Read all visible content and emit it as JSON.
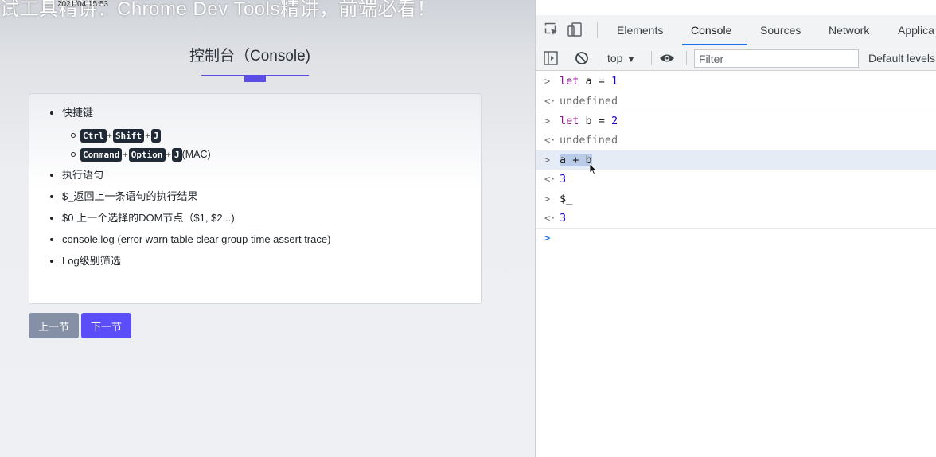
{
  "video": {
    "title": "试工具精讲：Chrome Dev Tools精讲，前端必看！",
    "timestamp": "2021/04 15:53"
  },
  "page": {
    "title": "控制台（Console)",
    "accent": "#5b4de6",
    "items": [
      {
        "label": "快捷键"
      },
      {
        "label": "执行语句"
      },
      {
        "label": "$_返回上一条语句的执行结果"
      },
      {
        "label": "$0 上一个选择的DOM节点（$1, $2...)"
      },
      {
        "label": "console.log (error warn table clear group time assert trace)"
      },
      {
        "label": "Log级别筛选"
      }
    ],
    "shortcuts": {
      "windows": [
        "Ctrl",
        "Shift",
        "J"
      ],
      "mac": [
        "Command",
        "Option",
        "J"
      ],
      "plus": "+",
      "mac_suffix": "(MAC)"
    },
    "buttons": {
      "prev": "上一节",
      "next": "下一节"
    },
    "colors": {
      "prev_button": "#8590a6",
      "next_button": "#5b4ef8"
    }
  },
  "devtools": {
    "tabs": [
      "Elements",
      "Console",
      "Sources",
      "Network",
      "Applica"
    ],
    "active_tab": "Console",
    "toolbar": {
      "context": "top",
      "filter_placeholder": "Filter",
      "levels": "Default levels"
    },
    "console": {
      "entries": [
        {
          "type": "input",
          "text": "let a = 1"
        },
        {
          "type": "output",
          "text": "undefined"
        },
        {
          "type": "input",
          "text": "let b = 2"
        },
        {
          "type": "output",
          "text": "undefined"
        },
        {
          "type": "input",
          "text": "a + b",
          "selected": true
        },
        {
          "type": "output",
          "text": "3"
        },
        {
          "type": "input",
          "text": "$_"
        },
        {
          "type": "output",
          "text": "3"
        }
      ],
      "input_prefix": ">",
      "output_prefix": "<·"
    },
    "colors": {
      "active_tab_underline": "#1a73e8",
      "keyword": "#8a1a8e",
      "number": "#1c00cf"
    }
  }
}
